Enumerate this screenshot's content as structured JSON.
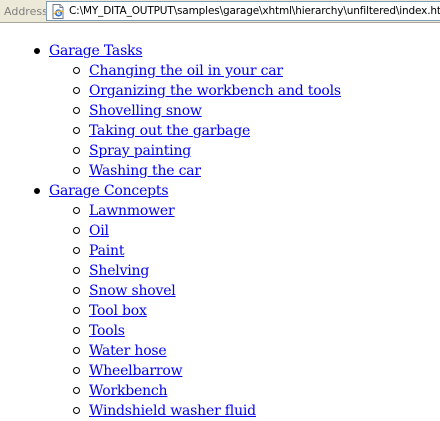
{
  "address_bar": {
    "label": "Address",
    "url": "C:\\MY_DITA_OUTPUT\\samples\\garage\\xhtml\\hierarchy\\unfiltered\\index.html",
    "icon": "ie-page-icon"
  },
  "tree": [
    {
      "label": "Garage Tasks",
      "children": [
        "Changing the oil in your car",
        "Organizing the workbench and tools",
        "Shovelling snow",
        "Taking out the garbage",
        "Spray painting",
        "Washing the car"
      ]
    },
    {
      "label": "Garage Concepts",
      "children": [
        "Lawnmower",
        "Oil",
        "Paint",
        "Shelving",
        "Snow shovel",
        "Tool box",
        "Tools",
        "Water hose",
        "Wheelbarrow",
        "Workbench",
        "Windshield washer fluid"
      ]
    }
  ]
}
